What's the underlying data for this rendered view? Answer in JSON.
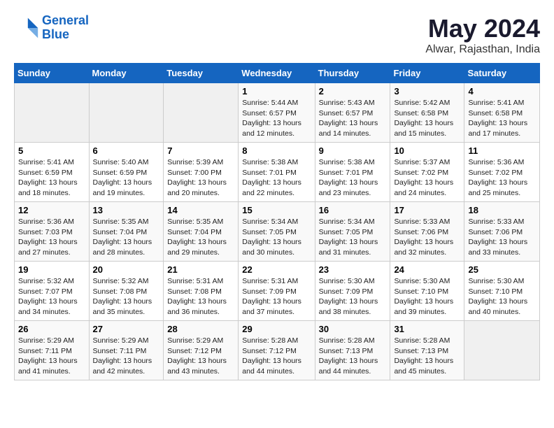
{
  "header": {
    "logo_line1": "General",
    "logo_line2": "Blue",
    "month": "May 2024",
    "location": "Alwar, Rajasthan, India"
  },
  "weekdays": [
    "Sunday",
    "Monday",
    "Tuesday",
    "Wednesday",
    "Thursday",
    "Friday",
    "Saturday"
  ],
  "weeks": [
    [
      {
        "day": "",
        "sunrise": "",
        "sunset": "",
        "daylight": ""
      },
      {
        "day": "",
        "sunrise": "",
        "sunset": "",
        "daylight": ""
      },
      {
        "day": "",
        "sunrise": "",
        "sunset": "",
        "daylight": ""
      },
      {
        "day": "1",
        "sunrise": "Sunrise: 5:44 AM",
        "sunset": "Sunset: 6:57 PM",
        "daylight": "Daylight: 13 hours and 12 minutes."
      },
      {
        "day": "2",
        "sunrise": "Sunrise: 5:43 AM",
        "sunset": "Sunset: 6:57 PM",
        "daylight": "Daylight: 13 hours and 14 minutes."
      },
      {
        "day": "3",
        "sunrise": "Sunrise: 5:42 AM",
        "sunset": "Sunset: 6:58 PM",
        "daylight": "Daylight: 13 hours and 15 minutes."
      },
      {
        "day": "4",
        "sunrise": "Sunrise: 5:41 AM",
        "sunset": "Sunset: 6:58 PM",
        "daylight": "Daylight: 13 hours and 17 minutes."
      }
    ],
    [
      {
        "day": "5",
        "sunrise": "Sunrise: 5:41 AM",
        "sunset": "Sunset: 6:59 PM",
        "daylight": "Daylight: 13 hours and 18 minutes."
      },
      {
        "day": "6",
        "sunrise": "Sunrise: 5:40 AM",
        "sunset": "Sunset: 6:59 PM",
        "daylight": "Daylight: 13 hours and 19 minutes."
      },
      {
        "day": "7",
        "sunrise": "Sunrise: 5:39 AM",
        "sunset": "Sunset: 7:00 PM",
        "daylight": "Daylight: 13 hours and 20 minutes."
      },
      {
        "day": "8",
        "sunrise": "Sunrise: 5:38 AM",
        "sunset": "Sunset: 7:01 PM",
        "daylight": "Daylight: 13 hours and 22 minutes."
      },
      {
        "day": "9",
        "sunrise": "Sunrise: 5:38 AM",
        "sunset": "Sunset: 7:01 PM",
        "daylight": "Daylight: 13 hours and 23 minutes."
      },
      {
        "day": "10",
        "sunrise": "Sunrise: 5:37 AM",
        "sunset": "Sunset: 7:02 PM",
        "daylight": "Daylight: 13 hours and 24 minutes."
      },
      {
        "day": "11",
        "sunrise": "Sunrise: 5:36 AM",
        "sunset": "Sunset: 7:02 PM",
        "daylight": "Daylight: 13 hours and 25 minutes."
      }
    ],
    [
      {
        "day": "12",
        "sunrise": "Sunrise: 5:36 AM",
        "sunset": "Sunset: 7:03 PM",
        "daylight": "Daylight: 13 hours and 27 minutes."
      },
      {
        "day": "13",
        "sunrise": "Sunrise: 5:35 AM",
        "sunset": "Sunset: 7:04 PM",
        "daylight": "Daylight: 13 hours and 28 minutes."
      },
      {
        "day": "14",
        "sunrise": "Sunrise: 5:35 AM",
        "sunset": "Sunset: 7:04 PM",
        "daylight": "Daylight: 13 hours and 29 minutes."
      },
      {
        "day": "15",
        "sunrise": "Sunrise: 5:34 AM",
        "sunset": "Sunset: 7:05 PM",
        "daylight": "Daylight: 13 hours and 30 minutes."
      },
      {
        "day": "16",
        "sunrise": "Sunrise: 5:34 AM",
        "sunset": "Sunset: 7:05 PM",
        "daylight": "Daylight: 13 hours and 31 minutes."
      },
      {
        "day": "17",
        "sunrise": "Sunrise: 5:33 AM",
        "sunset": "Sunset: 7:06 PM",
        "daylight": "Daylight: 13 hours and 32 minutes."
      },
      {
        "day": "18",
        "sunrise": "Sunrise: 5:33 AM",
        "sunset": "Sunset: 7:06 PM",
        "daylight": "Daylight: 13 hours and 33 minutes."
      }
    ],
    [
      {
        "day": "19",
        "sunrise": "Sunrise: 5:32 AM",
        "sunset": "Sunset: 7:07 PM",
        "daylight": "Daylight: 13 hours and 34 minutes."
      },
      {
        "day": "20",
        "sunrise": "Sunrise: 5:32 AM",
        "sunset": "Sunset: 7:08 PM",
        "daylight": "Daylight: 13 hours and 35 minutes."
      },
      {
        "day": "21",
        "sunrise": "Sunrise: 5:31 AM",
        "sunset": "Sunset: 7:08 PM",
        "daylight": "Daylight: 13 hours and 36 minutes."
      },
      {
        "day": "22",
        "sunrise": "Sunrise: 5:31 AM",
        "sunset": "Sunset: 7:09 PM",
        "daylight": "Daylight: 13 hours and 37 minutes."
      },
      {
        "day": "23",
        "sunrise": "Sunrise: 5:30 AM",
        "sunset": "Sunset: 7:09 PM",
        "daylight": "Daylight: 13 hours and 38 minutes."
      },
      {
        "day": "24",
        "sunrise": "Sunrise: 5:30 AM",
        "sunset": "Sunset: 7:10 PM",
        "daylight": "Daylight: 13 hours and 39 minutes."
      },
      {
        "day": "25",
        "sunrise": "Sunrise: 5:30 AM",
        "sunset": "Sunset: 7:10 PM",
        "daylight": "Daylight: 13 hours and 40 minutes."
      }
    ],
    [
      {
        "day": "26",
        "sunrise": "Sunrise: 5:29 AM",
        "sunset": "Sunset: 7:11 PM",
        "daylight": "Daylight: 13 hours and 41 minutes."
      },
      {
        "day": "27",
        "sunrise": "Sunrise: 5:29 AM",
        "sunset": "Sunset: 7:11 PM",
        "daylight": "Daylight: 13 hours and 42 minutes."
      },
      {
        "day": "28",
        "sunrise": "Sunrise: 5:29 AM",
        "sunset": "Sunset: 7:12 PM",
        "daylight": "Daylight: 13 hours and 43 minutes."
      },
      {
        "day": "29",
        "sunrise": "Sunrise: 5:28 AM",
        "sunset": "Sunset: 7:12 PM",
        "daylight": "Daylight: 13 hours and 44 minutes."
      },
      {
        "day": "30",
        "sunrise": "Sunrise: 5:28 AM",
        "sunset": "Sunset: 7:13 PM",
        "daylight": "Daylight: 13 hours and 44 minutes."
      },
      {
        "day": "31",
        "sunrise": "Sunrise: 5:28 AM",
        "sunset": "Sunset: 7:13 PM",
        "daylight": "Daylight: 13 hours and 45 minutes."
      },
      {
        "day": "",
        "sunrise": "",
        "sunset": "",
        "daylight": ""
      }
    ]
  ]
}
